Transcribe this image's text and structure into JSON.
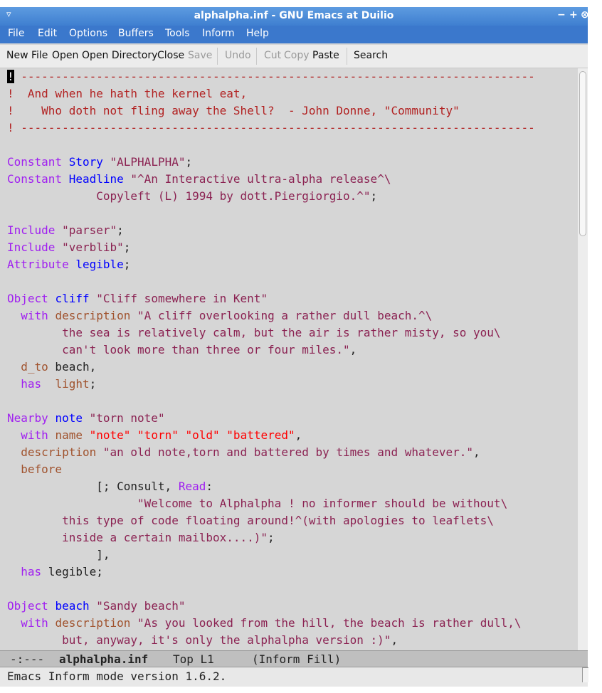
{
  "window": {
    "title": "alphalpha.inf - GNU Emacs at Duilio",
    "menu_glyph": "▿",
    "controls": {
      "minimize": "−",
      "maximize": "+",
      "close": "⊗"
    }
  },
  "menubar": {
    "items": [
      "File",
      "Edit",
      "Options",
      "Buffers",
      "Tools",
      "Inform",
      "Help"
    ]
  },
  "toolbar": {
    "new_file": "New File",
    "open": "Open",
    "open_directory": "Open Directory",
    "close": "Close",
    "save": "Save",
    "undo": "Undo",
    "cut": "Cut",
    "copy": "Copy",
    "paste": "Paste",
    "search": "Search"
  },
  "editor": {
    "lines": [
      [
        {
          "t": "!",
          "c": "cursor-char"
        },
        {
          "t": " ---------------------------------------------------------------------------",
          "c": "tok-comment"
        }
      ],
      [
        {
          "t": "!  And when he hath the kernel eat,",
          "c": "tok-comment"
        }
      ],
      [
        {
          "t": "!    Who doth not fling away the Shell?  - John Donne, \"Community\"",
          "c": "tok-comment"
        }
      ],
      [
        {
          "t": "! ---------------------------------------------------------------------------",
          "c": "tok-comment"
        }
      ],
      [],
      [
        {
          "t": "Constant",
          "c": "tok-keyword"
        },
        {
          "t": " ",
          "c": ""
        },
        {
          "t": "Story",
          "c": "tok-name"
        },
        {
          "t": " ",
          "c": ""
        },
        {
          "t": "\"ALPHALPHA\"",
          "c": "tok-string"
        },
        {
          "t": ";",
          "c": ""
        }
      ],
      [
        {
          "t": "Constant",
          "c": "tok-keyword"
        },
        {
          "t": " ",
          "c": ""
        },
        {
          "t": "Headline",
          "c": "tok-name"
        },
        {
          "t": " ",
          "c": ""
        },
        {
          "t": "\"^An Interactive ultra-alpha release^\\",
          "c": "tok-string"
        }
      ],
      [
        {
          "t": "             Copyleft (L) 1994 by dott.Piergiorgio.^\"",
          "c": "tok-string"
        },
        {
          "t": ";",
          "c": ""
        }
      ],
      [],
      [
        {
          "t": "Include",
          "c": "tok-keyword"
        },
        {
          "t": " ",
          "c": ""
        },
        {
          "t": "\"parser\"",
          "c": "tok-string"
        },
        {
          "t": ";",
          "c": ""
        }
      ],
      [
        {
          "t": "Include",
          "c": "tok-keyword"
        },
        {
          "t": " ",
          "c": ""
        },
        {
          "t": "\"verblib\"",
          "c": "tok-string"
        },
        {
          "t": ";",
          "c": ""
        }
      ],
      [
        {
          "t": "Attribute",
          "c": "tok-keyword"
        },
        {
          "t": " ",
          "c": ""
        },
        {
          "t": "legible",
          "c": "tok-name"
        },
        {
          "t": ";",
          "c": ""
        }
      ],
      [],
      [
        {
          "t": "Object",
          "c": "tok-keyword"
        },
        {
          "t": " ",
          "c": ""
        },
        {
          "t": "cliff",
          "c": "tok-name"
        },
        {
          "t": " ",
          "c": ""
        },
        {
          "t": "\"Cliff somewhere in Kent\"",
          "c": "tok-string"
        }
      ],
      [
        {
          "t": "  ",
          "c": ""
        },
        {
          "t": "with",
          "c": "tok-keyword"
        },
        {
          "t": " ",
          "c": ""
        },
        {
          "t": "description",
          "c": "tok-prop"
        },
        {
          "t": " ",
          "c": ""
        },
        {
          "t": "\"A cliff overlooking a rather dull beach.^\\",
          "c": "tok-string"
        }
      ],
      [
        {
          "t": "        the sea is relatively calm, but the air is rather misty, so you\\",
          "c": "tok-string"
        }
      ],
      [
        {
          "t": "        can't look more than three or four miles.\"",
          "c": "tok-string"
        },
        {
          "t": ",",
          "c": ""
        }
      ],
      [
        {
          "t": "  ",
          "c": ""
        },
        {
          "t": "d_to",
          "c": "tok-prop"
        },
        {
          "t": " beach,",
          "c": ""
        }
      ],
      [
        {
          "t": "  ",
          "c": ""
        },
        {
          "t": "has",
          "c": "tok-keyword"
        },
        {
          "t": "  ",
          "c": ""
        },
        {
          "t": "light",
          "c": "tok-prop"
        },
        {
          "t": ";",
          "c": ""
        }
      ],
      [],
      [
        {
          "t": "Nearby",
          "c": "tok-keyword"
        },
        {
          "t": " ",
          "c": ""
        },
        {
          "t": "note",
          "c": "tok-name"
        },
        {
          "t": " ",
          "c": ""
        },
        {
          "t": "\"torn note\"",
          "c": "tok-string"
        }
      ],
      [
        {
          "t": "  ",
          "c": ""
        },
        {
          "t": "with",
          "c": "tok-keyword"
        },
        {
          "t": " ",
          "c": ""
        },
        {
          "t": "name",
          "c": "tok-prop"
        },
        {
          "t": " ",
          "c": ""
        },
        {
          "t": "\"note\"",
          "c": "tok-vocab"
        },
        {
          "t": " ",
          "c": ""
        },
        {
          "t": "\"torn\"",
          "c": "tok-vocab"
        },
        {
          "t": " ",
          "c": ""
        },
        {
          "t": "\"old\"",
          "c": "tok-vocab"
        },
        {
          "t": " ",
          "c": ""
        },
        {
          "t": "\"battered\"",
          "c": "tok-vocab"
        },
        {
          "t": ",",
          "c": ""
        }
      ],
      [
        {
          "t": "  ",
          "c": ""
        },
        {
          "t": "description",
          "c": "tok-prop"
        },
        {
          "t": " ",
          "c": ""
        },
        {
          "t": "\"an old note,torn and battered by times and whatever.\"",
          "c": "tok-string"
        },
        {
          "t": ",",
          "c": ""
        }
      ],
      [
        {
          "t": "  ",
          "c": ""
        },
        {
          "t": "before",
          "c": "tok-prop"
        }
      ],
      [
        {
          "t": "             [; Consult, ",
          "c": ""
        },
        {
          "t": "Read",
          "c": "tok-keyword"
        },
        {
          "t": ":",
          "c": ""
        }
      ],
      [
        {
          "t": "                   \"Welcome to Alphalpha ! no informer should be without\\",
          "c": "tok-string"
        }
      ],
      [
        {
          "t": "        this type of code floating around!^(with apologies to leaflets\\",
          "c": "tok-string"
        }
      ],
      [
        {
          "t": "        inside a certain mailbox....)\"",
          "c": "tok-string"
        },
        {
          "t": ";",
          "c": ""
        }
      ],
      [
        {
          "t": "             ],",
          "c": ""
        }
      ],
      [
        {
          "t": "  ",
          "c": ""
        },
        {
          "t": "has",
          "c": "tok-keyword"
        },
        {
          "t": " legible;",
          "c": ""
        }
      ],
      [],
      [
        {
          "t": "Object",
          "c": "tok-keyword"
        },
        {
          "t": " ",
          "c": ""
        },
        {
          "t": "beach",
          "c": "tok-name"
        },
        {
          "t": " ",
          "c": ""
        },
        {
          "t": "\"Sandy beach\"",
          "c": "tok-string"
        }
      ],
      [
        {
          "t": "  ",
          "c": ""
        },
        {
          "t": "with",
          "c": "tok-keyword"
        },
        {
          "t": " ",
          "c": ""
        },
        {
          "t": "description",
          "c": "tok-prop"
        },
        {
          "t": " ",
          "c": ""
        },
        {
          "t": "\"As you looked from the hill, the beach is rather dull,\\",
          "c": "tok-string"
        }
      ],
      [
        {
          "t": "        but, anyway, it's only the alphalpha version :)\"",
          "c": "tok-string"
        },
        {
          "t": ",",
          "c": ""
        }
      ]
    ]
  },
  "modeline": {
    "status": "-:---",
    "buffer": "alphalpha.inf",
    "position": "Top L1",
    "mode": "(Inform Fill)"
  },
  "echo": {
    "message": "Emacs Inform mode version 1.6.2."
  },
  "colors": {
    "titlebar": "#3f7fd0",
    "menubar": "#3b78cc",
    "editor_bg": "#d6d6d6",
    "comment": "#b22222",
    "keyword": "#a020f0",
    "name": "#0000ff",
    "string": "#8b2252",
    "property": "#a0522d",
    "vocab": "#ff0000"
  }
}
